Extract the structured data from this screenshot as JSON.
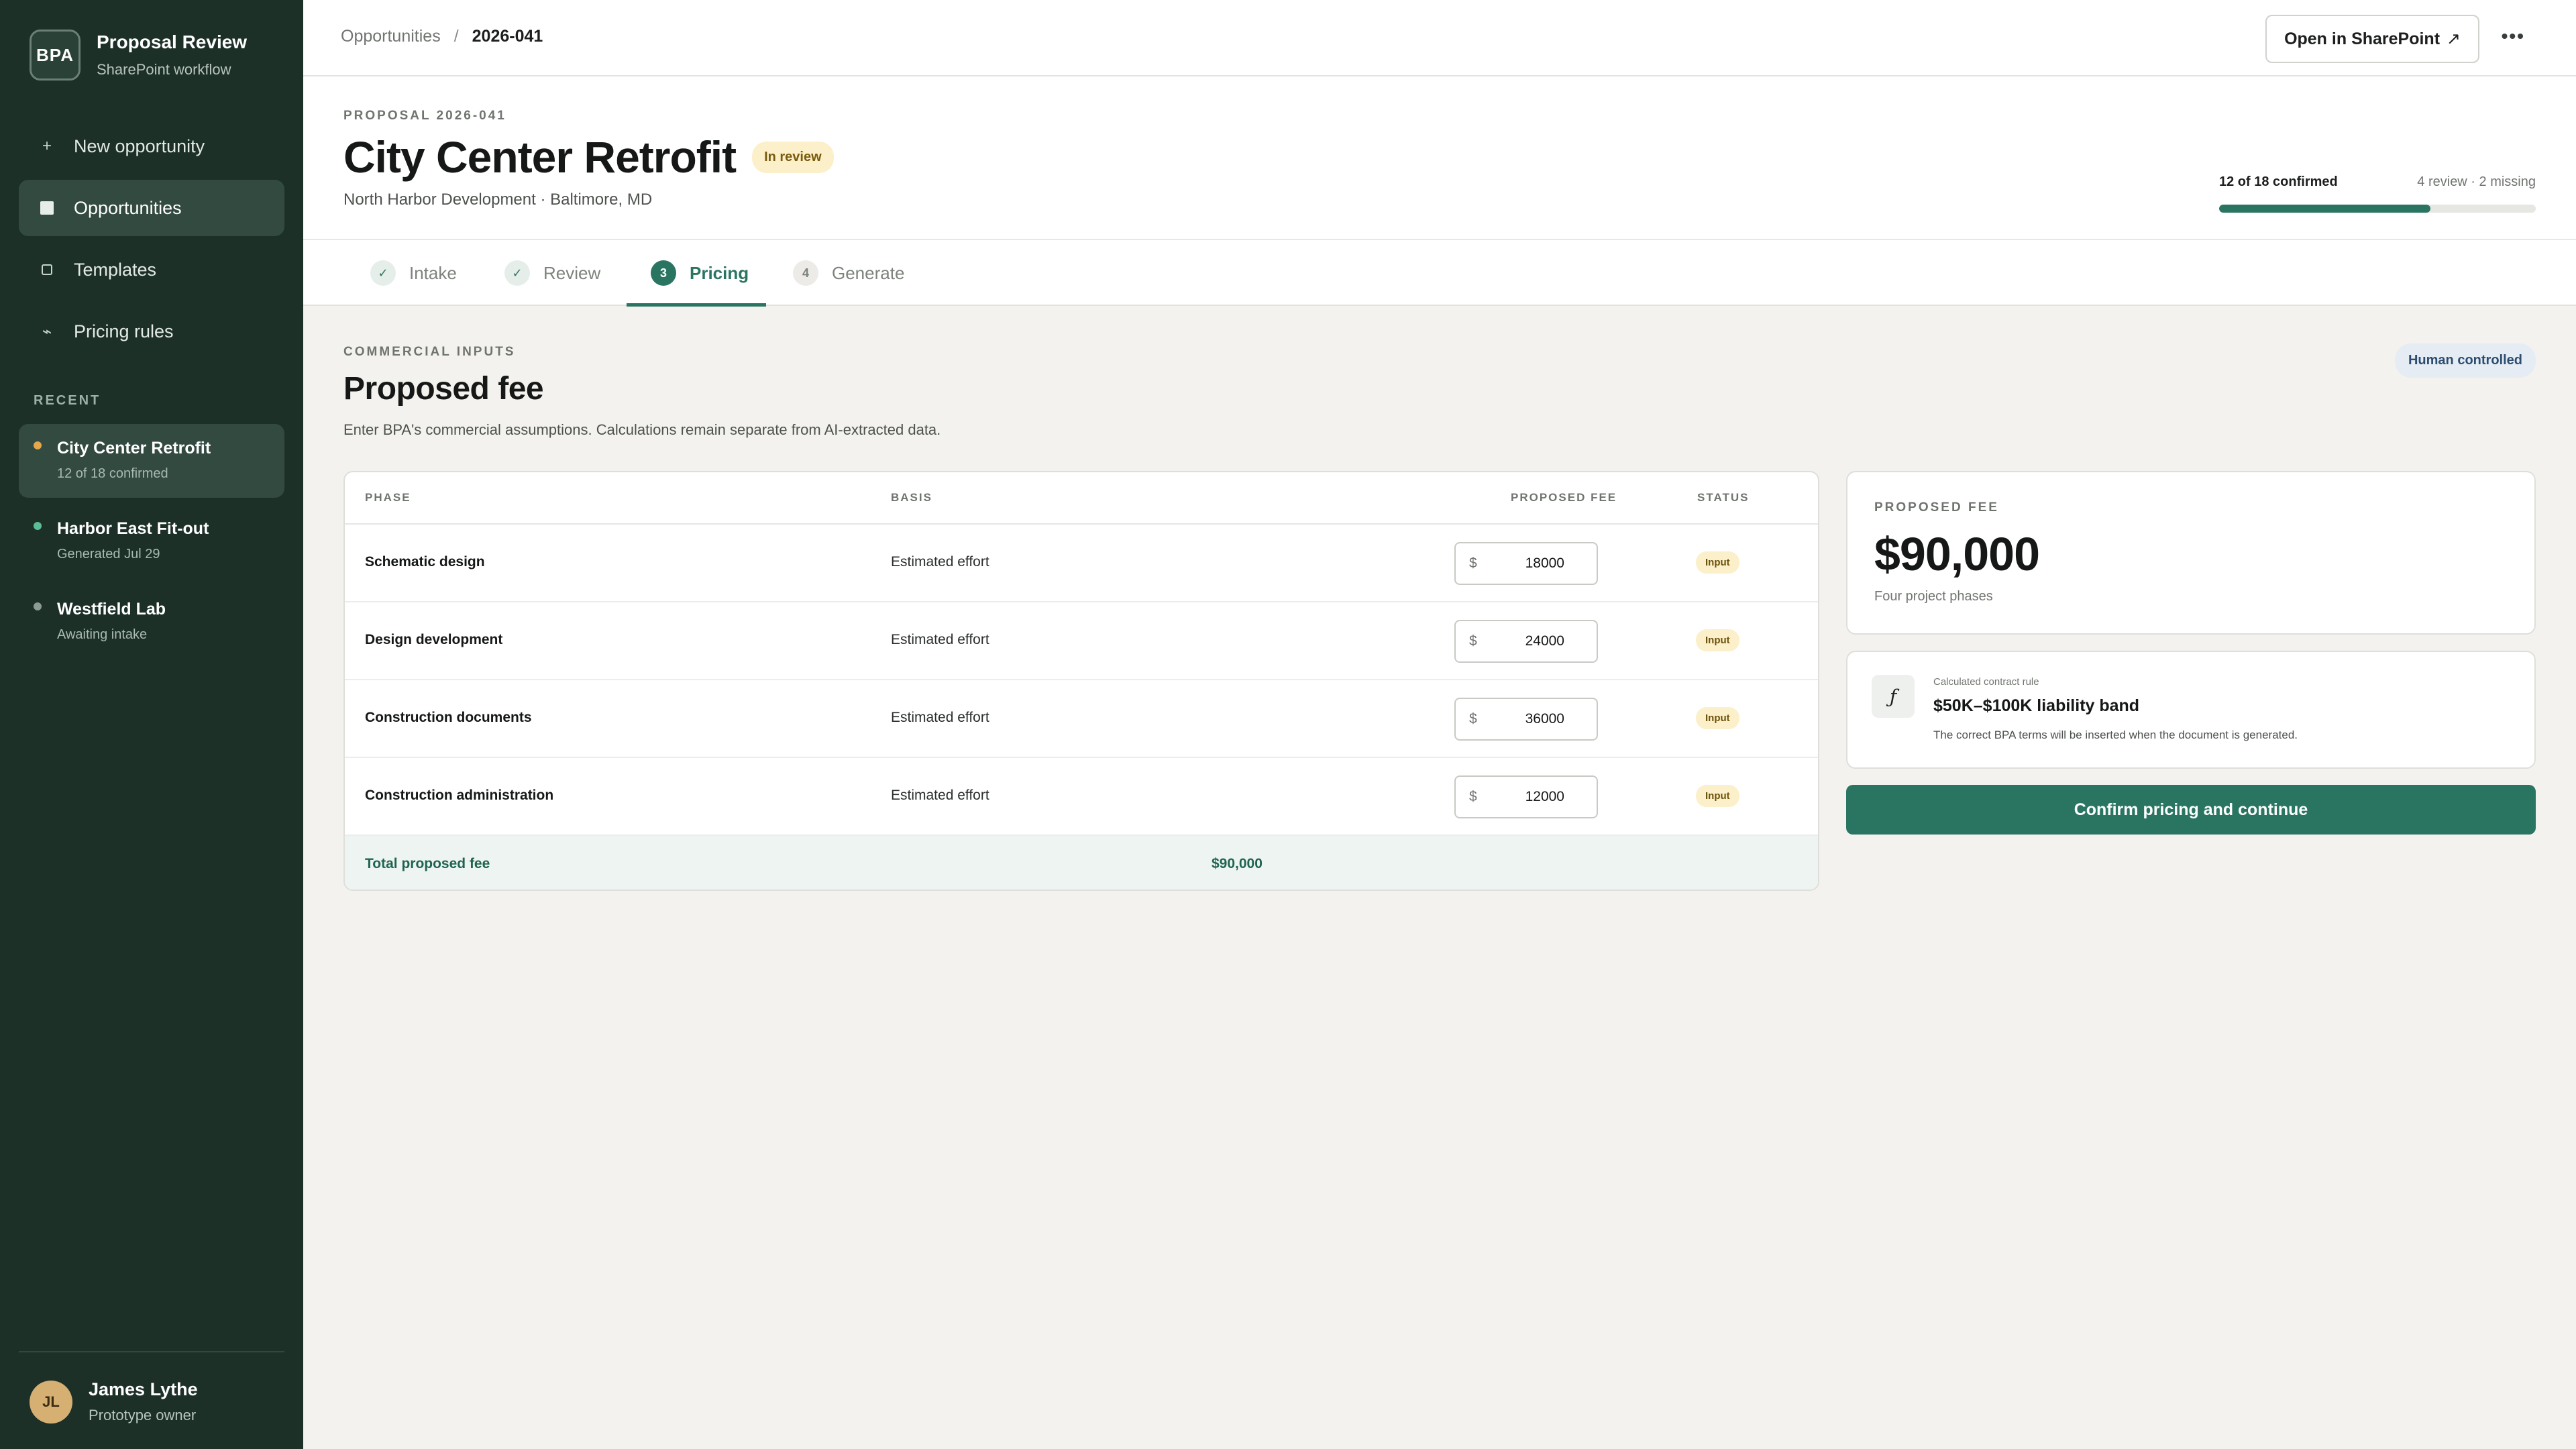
{
  "sidebar": {
    "brand_logo": "BPA",
    "brand_title": "Proposal Review",
    "brand_sub": "SharePoint workflow",
    "nav": [
      {
        "label": "New opportunity",
        "icon": "plus-icon"
      },
      {
        "label": "Opportunities",
        "icon": "grid-icon"
      },
      {
        "label": "Templates",
        "icon": "document-icon"
      },
      {
        "label": "Pricing rules",
        "icon": "rule-icon"
      }
    ],
    "recent_title": "RECENT",
    "recent": [
      {
        "name": "City Center Retrofit",
        "meta": "12 of 18 confirmed",
        "dot_color": "#e6a64a"
      },
      {
        "name": "Harbor East Fit-out",
        "meta": "Generated Jul 29",
        "dot_color": "#5bbd96"
      },
      {
        "name": "Westfield Lab",
        "meta": "Awaiting intake",
        "dot_color": "#8c9b93"
      }
    ],
    "user": {
      "initials": "JL",
      "name": "James Lythe",
      "role": "Prototype owner"
    }
  },
  "topbar": {
    "breadcrumb": [
      "Opportunities",
      "2026-041"
    ],
    "breadcrumb_sep": "/",
    "open_sharepoint": "Open in SharePoint",
    "open_icon": "↗",
    "more": "•••"
  },
  "header": {
    "eyebrow": "PROPOSAL 2026-041",
    "title": "City Center Retrofit",
    "status": "In review",
    "subtitle": "North Harbor Development · Baltimore, MD",
    "progress_main": "12 of 18 confirmed",
    "progress_side": "4 review · 2 missing",
    "progress_fraction": 0.667
  },
  "tabs": [
    {
      "label": "Intake",
      "marker": "✓",
      "state": "done"
    },
    {
      "label": "Review",
      "marker": "✓",
      "state": "done"
    },
    {
      "label": "Pricing",
      "marker": "3",
      "state": "current"
    },
    {
      "label": "Generate",
      "marker": "4",
      "state": "todo"
    }
  ],
  "section": {
    "eyebrow": "COMMERCIAL INPUTS",
    "title": "Proposed fee",
    "description": "Enter BPA's commercial assumptions. Calculations remain separate from AI-extracted data.",
    "human_pill": "Human controlled"
  },
  "table": {
    "headers": {
      "phase": "PHASE",
      "basis": "BASIS",
      "fee": "PROPOSED FEE",
      "status": "STATUS"
    },
    "currency": "$",
    "rows": [
      {
        "phase": "Schematic design",
        "basis": "Estimated effort",
        "fee": "18000",
        "status": "Input"
      },
      {
        "phase": "Design development",
        "basis": "Estimated effort",
        "fee": "24000",
        "status": "Input"
      },
      {
        "phase": "Construction documents",
        "basis": "Estimated effort",
        "fee": "36000",
        "status": "Input"
      },
      {
        "phase": "Construction administration",
        "basis": "Estimated effort",
        "fee": "12000",
        "status": "Input"
      }
    ],
    "total_label": "Total proposed fee",
    "total_value": "$90,000"
  },
  "fee_card": {
    "eyebrow": "PROPOSED FEE",
    "value": "$90,000",
    "note": "Four project phases"
  },
  "rule_card": {
    "icon": "ƒ",
    "eyebrow": "Calculated contract rule",
    "title": "$50K–$100K liability band",
    "description": "The correct BPA terms will be inserted when the document is generated."
  },
  "confirm_label": "Confirm pricing and continue"
}
